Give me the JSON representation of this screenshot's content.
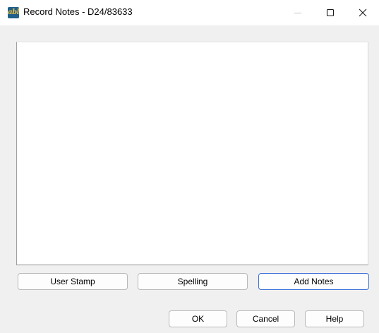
{
  "window": {
    "title": "Record Notes - D24/83633",
    "app_icon_text": "abl",
    "app_icon_name": "app-logo-icon",
    "controls": {
      "minimize_icon": "minimize-icon",
      "maximize_icon": "maximize-icon",
      "close_icon": "close-icon"
    }
  },
  "notes": {
    "value": ""
  },
  "actions": {
    "user_stamp_label": "User Stamp",
    "spelling_label": "Spelling",
    "add_notes_label": "Add Notes"
  },
  "footer": {
    "ok_label": "OK",
    "cancel_label": "Cancel",
    "help_label": "Help"
  },
  "colors": {
    "title_bar": "#ffffff",
    "dialog_background": "#f0f0f0",
    "default_button_border": "#3c6fd9",
    "app_icon_background": "#1f5f8b"
  }
}
